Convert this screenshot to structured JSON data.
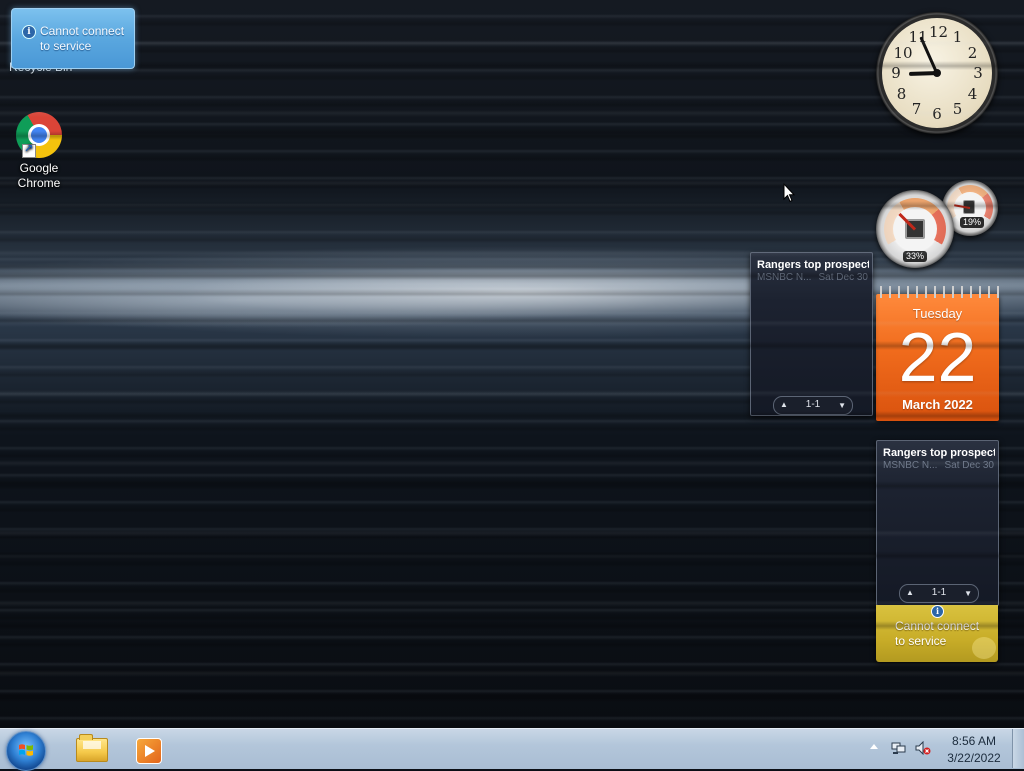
{
  "notification": {
    "message_line1": "Cannot connect",
    "message_line2": "to service"
  },
  "desktop": {
    "ghost_icon_label": "Recycle Bin",
    "icons": [
      {
        "label_line1": "Google",
        "label_line2": "Chrome",
        "icon": "chrome-icon"
      }
    ]
  },
  "clock_gadget": {
    "numbers": [
      "12",
      "1",
      "2",
      "3",
      "4",
      "5",
      "6",
      "7",
      "8",
      "9",
      "10",
      "11"
    ],
    "time": "8:56"
  },
  "cpu_meter": {
    "cpu_percent": "33%",
    "memory_percent": "19%",
    "cpu_value": 33,
    "memory_value": 19
  },
  "calendar": {
    "weekday": "Tuesday",
    "day": "22",
    "month_year": "March 2022",
    "accent": "#f06b1c"
  },
  "feeds": [
    {
      "headline": "Rangers top prospect...",
      "source": "MSNBC N...",
      "date": "Sat Dec 30",
      "page": "1-1"
    },
    {
      "headline": "Rangers top prospect...",
      "source": "MSNBC N...",
      "date": "Sat Dec 30",
      "page": "1-1"
    }
  ],
  "weather_gadget": {
    "message_line1": "Cannot connect",
    "message_line2": "to service"
  },
  "taskbar": {
    "pinned": [
      {
        "icon": "windows-explorer-icon"
      },
      {
        "icon": "media-player-icon"
      }
    ],
    "tray": {
      "time": "8:56 AM",
      "date": "3/22/2022",
      "icons": [
        "show-hidden-icons",
        "network-icon",
        "volume-muted-icon"
      ]
    }
  }
}
